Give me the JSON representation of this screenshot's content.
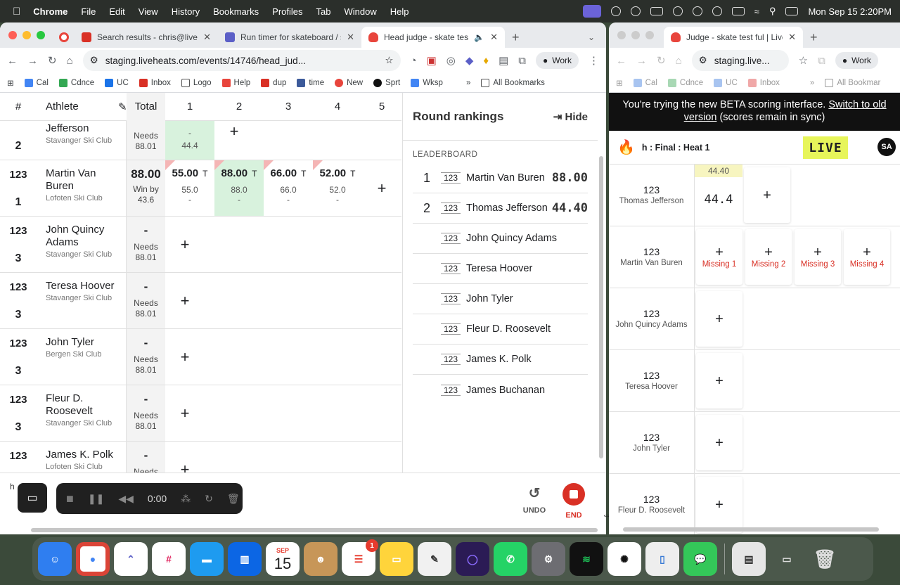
{
  "menubar": {
    "app": "Chrome",
    "items": [
      "File",
      "Edit",
      "View",
      "History",
      "Bookmarks",
      "Profiles",
      "Tab",
      "Window",
      "Help"
    ],
    "clock": "Mon Sep 15  2:20PM"
  },
  "left_window": {
    "tabs": [
      {
        "title": "Search results - chris@livehe",
        "fav_color": "#d93025"
      },
      {
        "title": "Run timer for skateboard / sc",
        "fav_color": "#5b5fc7"
      },
      {
        "title": "Head judge - skate test fu",
        "fav_color": "#e8453c"
      }
    ],
    "url": "staging.liveheats.com/events/14746/head_jud...",
    "work_label": "Work",
    "bookmarks": [
      "Cal",
      "Cdnce",
      "UC",
      "Inbox",
      "Logo",
      "Help",
      "dup",
      "time",
      "New",
      "Sprt",
      "Wksp"
    ],
    "all_bookmarks": "All Bookmarks",
    "grid": {
      "headers": {
        "num": "#",
        "athlete": "Athlete",
        "total": "Total",
        "runs": [
          "1",
          "2",
          "3",
          "4",
          "5"
        ]
      },
      "rows": [
        {
          "bib": "",
          "rank": "2",
          "name": "Jefferson",
          "club": "Stavanger Ski Club",
          "total": "",
          "total_label": "Needs 88.01",
          "run1_top": "-",
          "run1_val": "44.4"
        },
        {
          "bib": "123",
          "rank": "1",
          "name": "Martin Van Buren",
          "club": "Lofoten Ski Club",
          "total": "88.00",
          "total_label": "Win by 43.6",
          "runs": [
            {
              "score": "55.00",
              "t": "T",
              "sub": "55.0",
              "sub2": "-"
            },
            {
              "score": "88.00",
              "t": "T",
              "sub": "88.0",
              "sub2": "-"
            },
            {
              "score": "66.00",
              "t": "T",
              "sub": "66.0",
              "sub2": "-"
            },
            {
              "score": "52.00",
              "t": "T",
              "sub": "52.0",
              "sub2": "-"
            }
          ]
        },
        {
          "bib": "123",
          "rank": "3",
          "name": "John Quincy Adams",
          "club": "Stavanger Ski Club",
          "total": "-",
          "total_label": "Needs 88.01"
        },
        {
          "bib": "123",
          "rank": "3",
          "name": "Teresa Hoover",
          "club": "Stavanger Ski Club",
          "total": "-",
          "total_label": "Needs 88.01"
        },
        {
          "bib": "123",
          "rank": "3",
          "name": "John Tyler",
          "club": "Bergen Ski Club",
          "total": "-",
          "total_label": "Needs 88.01"
        },
        {
          "bib": "123",
          "rank": "3",
          "name": "Fleur D. Roosevelt",
          "club": "Stavanger Ski Club",
          "total": "-",
          "total_label": "Needs 88.01"
        },
        {
          "bib": "123",
          "rank": "",
          "name": "James K. Polk",
          "club": "Lofoten Ski Club",
          "total": "-",
          "total_label": "Needs"
        }
      ]
    },
    "rankings": {
      "title": "Round rankings",
      "hide": "Hide",
      "leaderboard": "LEADERBOARD",
      "entries": [
        {
          "pos": "1",
          "bib": "123",
          "name": "Martin Van Buren",
          "score": "88.00"
        },
        {
          "pos": "2",
          "bib": "123",
          "name": "Thomas Jefferson",
          "score": "44.40"
        },
        {
          "pos": "",
          "bib": "123",
          "name": "John Quincy Adams",
          "score": ""
        },
        {
          "pos": "",
          "bib": "123",
          "name": "Teresa Hoover",
          "score": ""
        },
        {
          "pos": "",
          "bib": "123",
          "name": "John Tyler",
          "score": ""
        },
        {
          "pos": "",
          "bib": "123",
          "name": "Fleur D. Roosevelt",
          "score": ""
        },
        {
          "pos": "",
          "bib": "123",
          "name": "James K. Polk",
          "score": ""
        },
        {
          "pos": "",
          "bib": "123",
          "name": "James Buchanan",
          "score": ""
        }
      ]
    },
    "bottom": {
      "h_label": "h",
      "timer": "0:00",
      "undo": "UNDO",
      "end": "END"
    }
  },
  "right_window": {
    "tab_title": "Judge - skate test ful | Liveh",
    "url": "staging.live...",
    "work_label": "Work",
    "bookmarks": [
      "Cal",
      "Cdnce",
      "UC",
      "Inbox"
    ],
    "all_bookmarks": "All Bookmar",
    "beta_line1": "You're trying the new BETA scoring interface.",
    "beta_link1": "Switch to old",
    "beta_link2": "version",
    "beta_line2": "(scores remain in sync)",
    "heat_title": "h : Final : Heat 1",
    "live": "LIVE",
    "avatar": "SA",
    "rows": [
      {
        "bib": "123",
        "name": "Thomas Jefferson",
        "tag": "44.40",
        "score": "44.4"
      },
      {
        "bib": "123",
        "name": "Martin Van Buren",
        "missing": [
          "Missing 1",
          "Missing 2",
          "Missing 3",
          "Missing 4"
        ]
      },
      {
        "bib": "123",
        "name": "John Quincy Adams"
      },
      {
        "bib": "123",
        "name": "Teresa Hoover"
      },
      {
        "bib": "123",
        "name": "John Tyler"
      },
      {
        "bib": "123",
        "name": "Fleur D. Roosevelt"
      }
    ]
  },
  "dock": {
    "calendar_month": "SEP",
    "calendar_day": "15",
    "reminders_badge": "1"
  }
}
